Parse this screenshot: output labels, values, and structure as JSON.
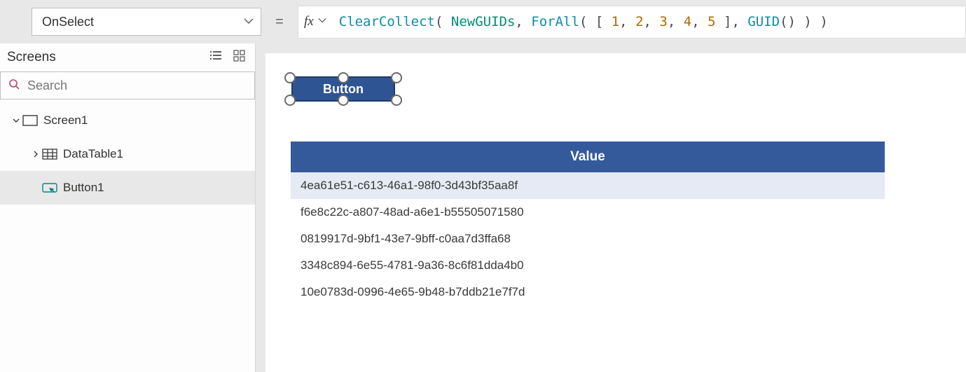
{
  "property_selector": {
    "value": "OnSelect"
  },
  "equals": "=",
  "formula": {
    "tokens": [
      {
        "t": "ClearCollect",
        "c": "tok-fn"
      },
      {
        "t": "( ",
        "c": "tok-paren"
      },
      {
        "t": "NewGUIDs",
        "c": "tok-ident"
      },
      {
        "t": ", ",
        "c": "tok-comma"
      },
      {
        "t": "ForAll",
        "c": "tok-fn"
      },
      {
        "t": "( ",
        "c": "tok-paren"
      },
      {
        "t": "[ ",
        "c": "tok-bracket"
      },
      {
        "t": "1",
        "c": "tok-num"
      },
      {
        "t": ", ",
        "c": "tok-comma"
      },
      {
        "t": "2",
        "c": "tok-num"
      },
      {
        "t": ", ",
        "c": "tok-comma"
      },
      {
        "t": "3",
        "c": "tok-num"
      },
      {
        "t": ", ",
        "c": "tok-comma"
      },
      {
        "t": "4",
        "c": "tok-num"
      },
      {
        "t": ", ",
        "c": "tok-comma"
      },
      {
        "t": "5",
        "c": "tok-num"
      },
      {
        "t": " ]",
        "c": "tok-bracket"
      },
      {
        "t": ", ",
        "c": "tok-comma"
      },
      {
        "t": "GUID",
        "c": "tok-fn"
      },
      {
        "t": "() ",
        "c": "tok-paren"
      },
      {
        "t": ") ",
        "c": "tok-paren"
      },
      {
        "t": ")",
        "c": "tok-paren"
      }
    ]
  },
  "panel": {
    "title": "Screens",
    "search_placeholder": "Search"
  },
  "tree": {
    "screen": {
      "label": "Screen1"
    },
    "datatable": {
      "label": "DataTable1"
    },
    "button": {
      "label": "Button1"
    }
  },
  "canvas": {
    "button_label": "Button",
    "table": {
      "header": "Value",
      "rows": [
        "4ea61e51-c613-46a1-98f0-3d43bf35aa8f",
        "f6e8c22c-a807-48ad-a6e1-b55505071580",
        "0819917d-9bf1-43e7-9bff-c0aa7d3ffa68",
        "3348c894-6e55-4781-9a36-8c6f81dda4b0",
        "10e0783d-0996-4e65-9b48-b7ddb21e7f7d"
      ]
    }
  }
}
